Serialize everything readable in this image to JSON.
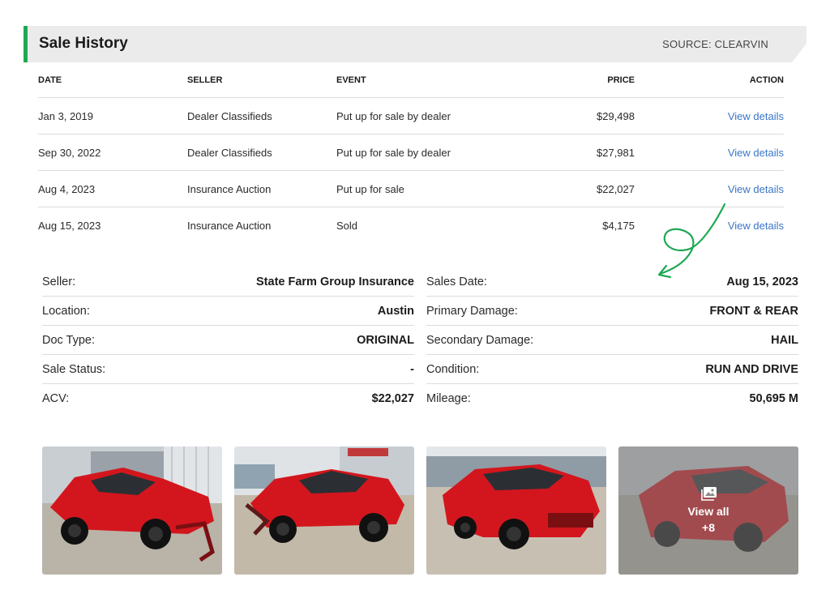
{
  "header": {
    "title": "Sale History",
    "source": "SOURCE: CLEARVIN",
    "accent_color": "#1fa854"
  },
  "table": {
    "columns": {
      "date": "DATE",
      "seller": "SELLER",
      "event": "EVENT",
      "price": "PRICE",
      "action": "ACTION"
    },
    "rows": [
      {
        "date": "Jan 3, 2019",
        "seller": "Dealer Classifieds",
        "event": "Put up for sale by dealer",
        "price": "$29,498",
        "action": "View details"
      },
      {
        "date": "Sep 30, 2022",
        "seller": "Dealer Classifieds",
        "event": "Put up for sale by dealer",
        "price": "$27,981",
        "action": "View details"
      },
      {
        "date": "Aug 4, 2023",
        "seller": "Insurance Auction",
        "event": "Put up for sale",
        "price": "$22,027",
        "action": "View details"
      },
      {
        "date": "Aug 15, 2023",
        "seller": "Insurance Auction",
        "event": "Sold",
        "price": "$4,175",
        "action": "View details"
      }
    ],
    "link_color": "#3a76c8"
  },
  "details": {
    "left": [
      {
        "label": "Seller:",
        "value": "State Farm Group Insurance"
      },
      {
        "label": "Location:",
        "value": "Austin"
      },
      {
        "label": "Doc Type:",
        "value": "ORIGINAL"
      },
      {
        "label": "Sale Status:",
        "value": "-"
      },
      {
        "label": "ACV:",
        "value": "$22,027"
      }
    ],
    "right": [
      {
        "label": "Sales Date:",
        "value": "Aug 15, 2023"
      },
      {
        "label": "Primary Damage:",
        "value": "FRONT & REAR"
      },
      {
        "label": "Secondary Damage:",
        "value": "HAIL"
      },
      {
        "label": "Condition:",
        "value": "RUN AND DRIVE"
      },
      {
        "label": "Mileage:",
        "value": "50,695 M"
      }
    ]
  },
  "photos": {
    "view_all_label": "View all",
    "view_all_count": "+8",
    "icon": "gallery-icon"
  }
}
